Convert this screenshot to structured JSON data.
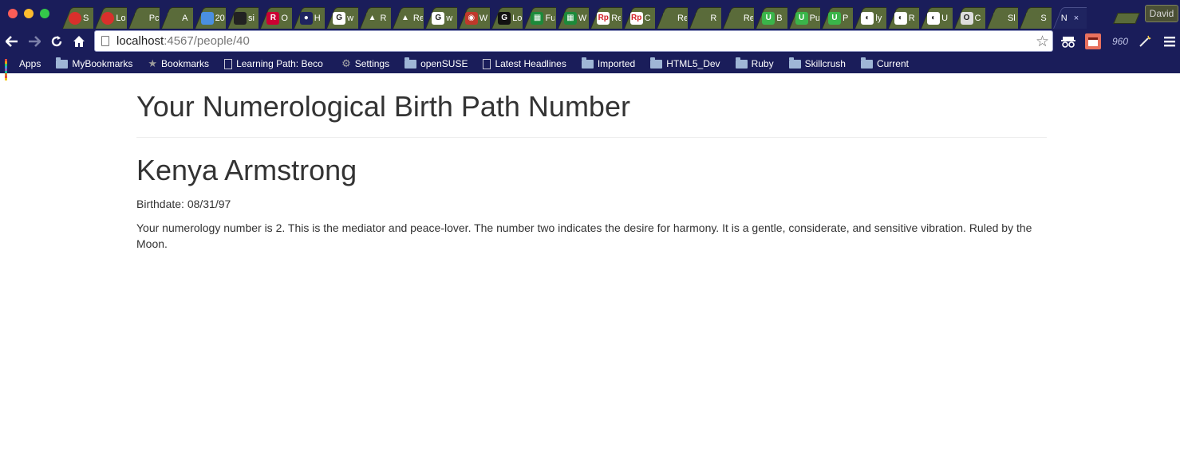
{
  "browser": {
    "window_controls": [
      "close",
      "minimize",
      "zoom"
    ],
    "tabs": [
      {
        "favicon": "red-circle-icon",
        "favicon_color": "#d9302c",
        "favicon_text": "",
        "title": "S"
      },
      {
        "favicon": "red-circle-icon",
        "favicon_color": "#d9302c",
        "favicon_text": "",
        "title": "Lo"
      },
      {
        "favicon": "blank-page-icon",
        "favicon_color": "#5a6b3a",
        "favicon_text": "",
        "title": "Pc"
      },
      {
        "favicon": "blank-page-icon",
        "favicon_color": "#5a6b3a",
        "favicon_text": "",
        "title": "A"
      },
      {
        "favicon": "calendar-icon",
        "favicon_color": "#4a8fe0",
        "favicon_text": "",
        "title": "20"
      },
      {
        "favicon": "github-icon",
        "favicon_color": "#222222",
        "favicon_text": "",
        "title": "si"
      },
      {
        "favicon": "ruby-r-icon",
        "favicon_color": "#cc0033",
        "favicon_text": "R",
        "title": "O"
      },
      {
        "favicon": "flickr-icon",
        "favicon_color": "#1f2460",
        "favicon_text": "●",
        "title": "H"
      },
      {
        "favicon": "google-icon",
        "favicon_color": "#ffffff",
        "favicon_text": "G",
        "title": "w"
      },
      {
        "favicon": "triangle-icon",
        "favicon_color": "#5a6b3a",
        "favicon_text": "▲",
        "title": "R"
      },
      {
        "favicon": "triangle-icon",
        "favicon_color": "#5a6b3a",
        "favicon_text": "▲",
        "title": "Re"
      },
      {
        "favicon": "google-icon",
        "favicon_color": "#ffffff",
        "favicon_text": "G",
        "title": "w"
      },
      {
        "favicon": "shield-icon",
        "favicon_color": "#c0392b",
        "favicon_text": "◉",
        "title": "W"
      },
      {
        "favicon": "goodreads-icon",
        "favicon_color": "#111111",
        "favicon_text": "G",
        "title": "Lo"
      },
      {
        "favicon": "terminal-icon",
        "favicon_color": "#1d8a3a",
        "favicon_text": "▦",
        "title": "Fu"
      },
      {
        "favicon": "terminal-icon",
        "favicon_color": "#1d8a3a",
        "favicon_text": "▦",
        "title": "W"
      },
      {
        "favicon": "rp-icon",
        "favicon_color": "#ffffff",
        "favicon_text": "Rp",
        "title": "Re"
      },
      {
        "favicon": "rp-icon",
        "favicon_color": "#ffffff",
        "favicon_text": "Rp",
        "title": "C"
      },
      {
        "favicon": "blank-page-icon",
        "favicon_color": "#5a6b3a",
        "favicon_text": "",
        "title": "Re"
      },
      {
        "favicon": "blank-page-icon",
        "favicon_color": "#5a6b3a",
        "favicon_text": "",
        "title": "R"
      },
      {
        "favicon": "blank-page-icon",
        "favicon_color": "#5a6b3a",
        "favicon_text": "",
        "title": "Re"
      },
      {
        "favicon": "u-green-icon",
        "favicon_color": "#3ab54a",
        "favicon_text": "U",
        "title": "B"
      },
      {
        "favicon": "u-green-icon",
        "favicon_color": "#3ab54a",
        "favicon_text": "U",
        "title": "Pu"
      },
      {
        "favicon": "u-green-icon",
        "favicon_color": "#3ab54a",
        "favicon_text": "U",
        "title": "P"
      },
      {
        "favicon": "panda-icon",
        "favicon_color": "#ffffff",
        "favicon_text": "◐",
        "title": "ly"
      },
      {
        "favicon": "panda-icon",
        "favicon_color": "#ffffff",
        "favicon_text": "◐",
        "title": "R"
      },
      {
        "favicon": "panda-icon",
        "favicon_color": "#ffffff",
        "favicon_text": "◐",
        "title": "U"
      },
      {
        "favicon": "o-box-icon",
        "favicon_color": "#dddddd",
        "favicon_text": "O",
        "title": "C"
      },
      {
        "favicon": "blank-page-icon",
        "favicon_color": "#5a6b3a",
        "favicon_text": "",
        "title": "Sl"
      },
      {
        "favicon": "blank-page-icon",
        "favicon_color": "#5a6b3a",
        "favicon_text": "",
        "title": "S"
      },
      {
        "favicon": "none",
        "favicon_color": "#1f2460",
        "favicon_text": "",
        "title": "N",
        "active": true
      }
    ],
    "active_tab_close": "×",
    "profile_name": "David",
    "url_host": "localhost",
    "url_rest": ":4567/people/40",
    "extensions": [
      "incognito-icon",
      "calendar-ext-icon",
      "960-icon",
      "wand-icon",
      "menu-icon"
    ],
    "ext_960_label": "960"
  },
  "bookmarks": [
    {
      "icon": "apps-icon",
      "label": "Apps"
    },
    {
      "icon": "folder-icon",
      "label": "MyBookmarks"
    },
    {
      "icon": "star-icon",
      "label": "Bookmarks"
    },
    {
      "icon": "page-icon",
      "label": "Learning Path: Beco"
    },
    {
      "icon": "gear-icon",
      "label": "Settings"
    },
    {
      "icon": "folder-icon",
      "label": "openSUSE"
    },
    {
      "icon": "page-icon",
      "label": "Latest Headlines"
    },
    {
      "icon": "folder-icon",
      "label": "Imported"
    },
    {
      "icon": "folder-icon",
      "label": "HTML5_Dev"
    },
    {
      "icon": "folder-icon",
      "label": "Ruby"
    },
    {
      "icon": "folder-icon",
      "label": "Skillcrush"
    },
    {
      "icon": "folder-icon",
      "label": "Current"
    }
  ],
  "page": {
    "title": "Your Numerological Birth Path Number",
    "person_name": "Kenya Armstrong",
    "birthdate": "Birthdate: 08/31/97",
    "description": "Your numerology number is 2. This is the mediator and peace-lover. The number two indicates the desire for harmony. It is a gentle, considerate, and sensitive vibration. Ruled by the Moon."
  }
}
